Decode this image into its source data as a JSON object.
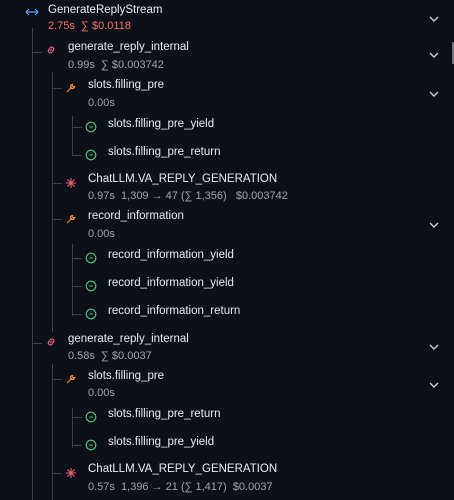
{
  "colors": {
    "background": "#0d1117",
    "text": "#e6edf3",
    "muted": "#9da5ae",
    "accent_red": "#f47067",
    "link_icon": "#e0607e",
    "wrench_icon": "#e8894a",
    "llm_icon": "#e0607e",
    "yield_icon": "#4ecb8a",
    "root_icon": "#58a6ff"
  },
  "root": {
    "title": "GenerateReplyStream",
    "duration": "2.75s",
    "cost": "∑ $0.0118"
  },
  "nodes": [
    {
      "id": "n1",
      "title": "generate_reply_internal",
      "meta": "0.99s  ∑ $0.003742",
      "icon": "link-icon"
    },
    {
      "id": "n2",
      "title": "slots.filling_pre",
      "meta": "0.00s",
      "icon": "wrench-icon"
    },
    {
      "id": "n3",
      "title": "slots.filling_pre_yield",
      "icon": "yield-icon"
    },
    {
      "id": "n4",
      "title": "slots.filling_pre_return",
      "icon": "yield-icon"
    },
    {
      "id": "n5",
      "title": "ChatLLM.VA_REPLY_GENERATION",
      "meta": "0.97s  1,309 → 47 (∑ 1,356)   $0.003742",
      "icon": "llm-icon"
    },
    {
      "id": "n6",
      "title": "record_information",
      "meta": "0.00s",
      "icon": "wrench-icon"
    },
    {
      "id": "n7",
      "title": "record_information_yield",
      "icon": "yield-icon"
    },
    {
      "id": "n8",
      "title": "record_information_yield",
      "icon": "yield-icon"
    },
    {
      "id": "n9",
      "title": "record_information_return",
      "icon": "yield-icon"
    },
    {
      "id": "n10",
      "title": "generate_reply_internal",
      "meta": "0.58s  ∑ $0.0037",
      "icon": "link-icon"
    },
    {
      "id": "n11",
      "title": "slots.filling_pre",
      "meta": "0.00s",
      "icon": "wrench-icon"
    },
    {
      "id": "n12",
      "title": "slots.filling_pre_return",
      "icon": "yield-icon"
    },
    {
      "id": "n13",
      "title": "slots.filling_pre_yield",
      "icon": "yield-icon"
    },
    {
      "id": "n14",
      "title": "ChatLLM.VA_REPLY_GENERATION",
      "meta": "0.57s  1,396 → 21 (∑ 1,417)  $0.0037",
      "icon": "llm-icon"
    }
  ]
}
